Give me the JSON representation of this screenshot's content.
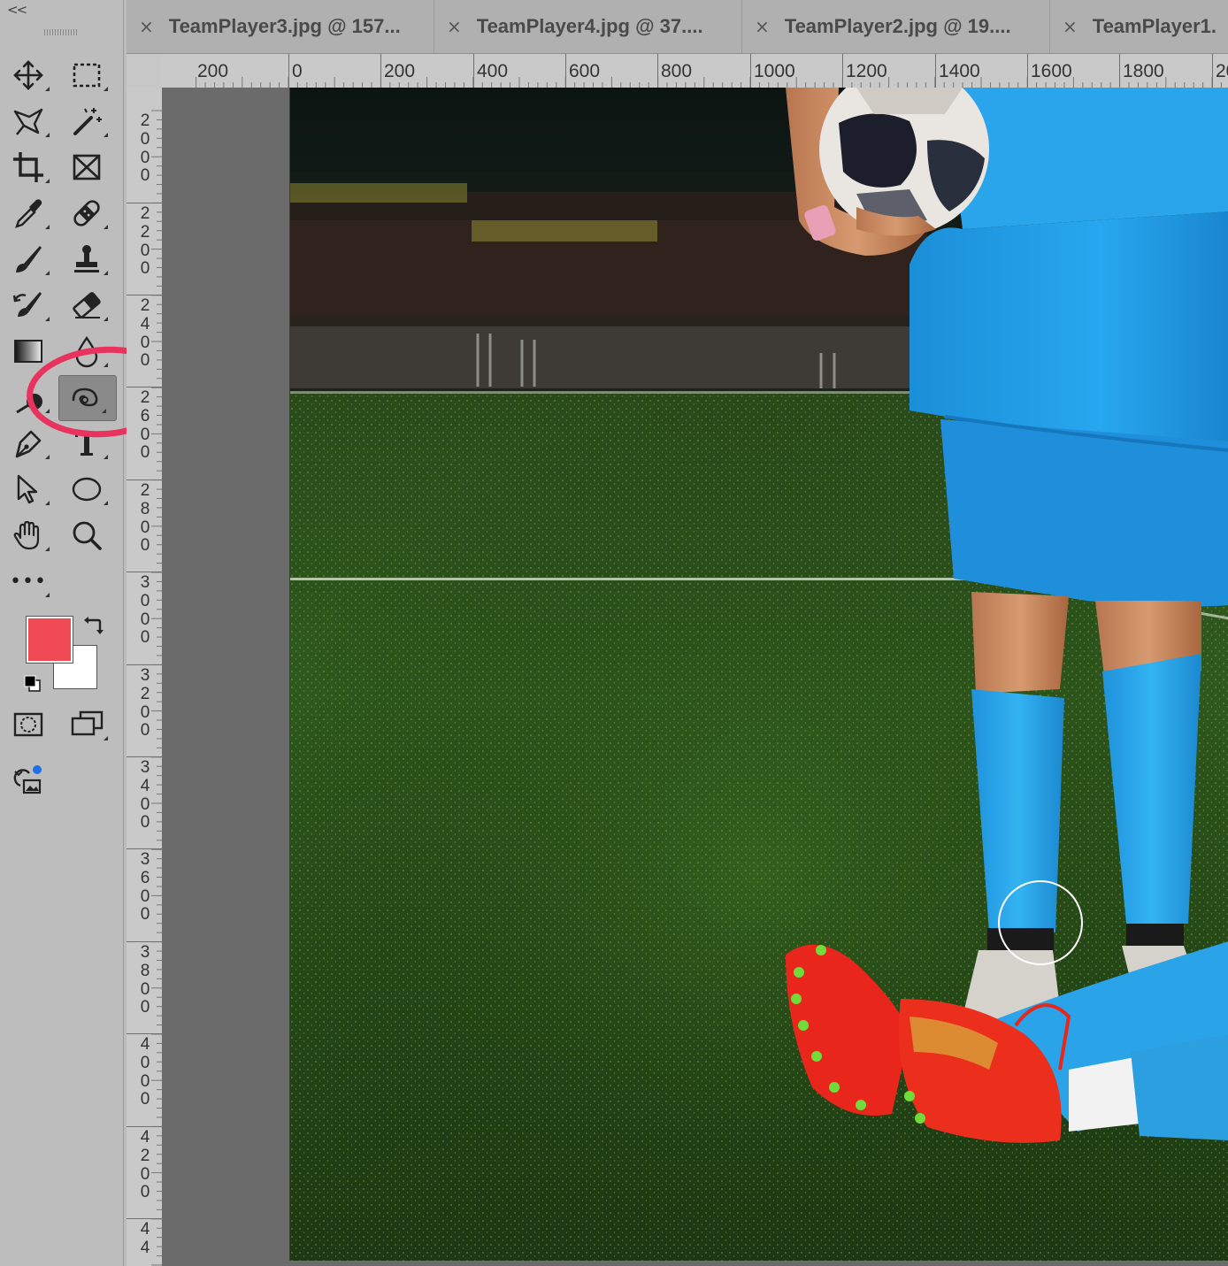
{
  "toolbar": {
    "collapse_label": "<<",
    "more_tools_label": "•••",
    "colors": {
      "foreground": "#f24a55",
      "background": "#ffffff"
    },
    "highlight_color": "#e8335e",
    "tools": [
      {
        "name": "move-tool",
        "icon": "move-icon"
      },
      {
        "name": "rectangular-marquee-tool",
        "icon": "marquee-icon"
      },
      {
        "name": "lasso-tool",
        "icon": "lasso-icon"
      },
      {
        "name": "magic-wand-tool",
        "icon": "magic-wand-icon"
      },
      {
        "name": "crop-tool",
        "icon": "crop-icon"
      },
      {
        "name": "frame-tool",
        "icon": "frame-icon"
      },
      {
        "name": "eyedropper-tool",
        "icon": "eyedropper-icon"
      },
      {
        "name": "healing-brush-tool",
        "icon": "bandage-icon"
      },
      {
        "name": "brush-tool",
        "icon": "brush-icon"
      },
      {
        "name": "clone-stamp-tool",
        "icon": "stamp-icon"
      },
      {
        "name": "history-brush-tool",
        "icon": "history-brush-icon"
      },
      {
        "name": "eraser-tool",
        "icon": "eraser-icon"
      },
      {
        "name": "gradient-tool",
        "icon": "gradient-icon"
      },
      {
        "name": "blur-tool",
        "icon": "drop-icon"
      },
      {
        "name": "dodge-tool",
        "icon": "dodge-icon"
      },
      {
        "name": "smudge-tool",
        "icon": "smudge-icon",
        "active": true
      },
      {
        "name": "pen-tool",
        "icon": "pen-icon"
      },
      {
        "name": "type-tool",
        "icon": "type-icon"
      },
      {
        "name": "path-selection-tool",
        "icon": "arrow-icon"
      },
      {
        "name": "ellipse-tool",
        "icon": "ellipse-icon"
      },
      {
        "name": "hand-tool",
        "icon": "hand-icon"
      },
      {
        "name": "zoom-tool",
        "icon": "zoom-icon"
      },
      {
        "name": "edit-toolbar",
        "icon": "more-icon"
      },
      {
        "name": "quick-mask-mode",
        "icon": "quick-mask-icon"
      },
      {
        "name": "screen-mode",
        "icon": "screen-mode-icon"
      },
      {
        "name": "content-credentials",
        "icon": "content-credentials-icon"
      }
    ]
  },
  "tabs": [
    {
      "title": "TeamPlayer3.jpg @ 157...",
      "close": "×"
    },
    {
      "title": "TeamPlayer4.jpg @ 37....",
      "close": "×"
    },
    {
      "title": "TeamPlayer2.jpg @ 19....",
      "close": "×"
    },
    {
      "title": "TeamPlayer1.",
      "close": "×"
    }
  ],
  "rulers": {
    "horizontal": [
      "200",
      "0",
      "200",
      "400",
      "600",
      "800",
      "1000",
      "1200",
      "1400",
      "1600",
      "1800",
      "20"
    ],
    "vertical": [
      "2000",
      "2200",
      "2400",
      "2600",
      "2800",
      "3000",
      "3200",
      "3400",
      "3600",
      "3800",
      "4000",
      "4200",
      "44"
    ]
  },
  "canvas": {
    "image_description_icon": "soccer-players-photo",
    "brush_cursor_icon": "brush-circle-cursor-icon"
  }
}
